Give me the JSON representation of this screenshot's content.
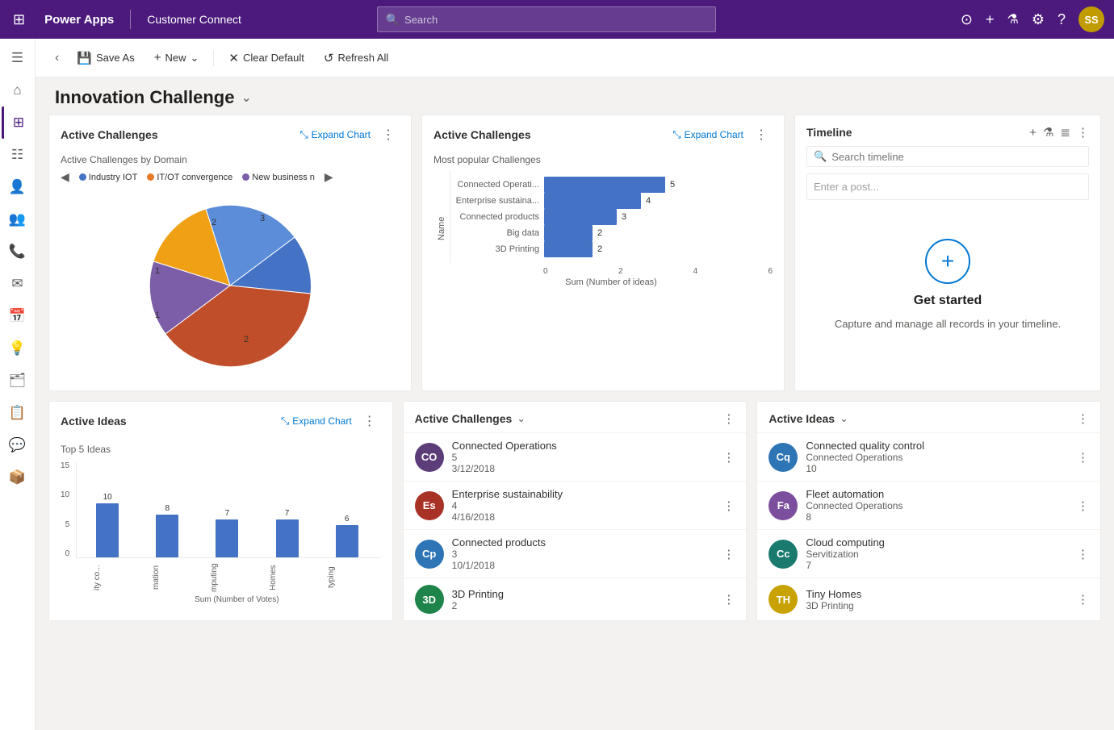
{
  "topnav": {
    "app_name": "Power Apps",
    "env_name": "Customer Connect",
    "search_placeholder": "Search",
    "avatar_initials": "SS"
  },
  "commandbar": {
    "back_title": "Back",
    "save_as": "Save As",
    "new": "New",
    "clear_default": "Clear Default",
    "refresh_all": "Refresh All"
  },
  "page": {
    "title": "Innovation Challenge",
    "title_chevron": "⌄"
  },
  "active_challenges_pie": {
    "title": "Active Challenges",
    "expand_label": "Expand Chart",
    "subtitle": "Active Challenges by Domain",
    "legend": [
      {
        "label": "Industry IOT",
        "color": "#4472c4"
      },
      {
        "label": "IT/OT convergence",
        "color": "#e87a24"
      },
      {
        "label": "New business n",
        "color": "#7b5ea7"
      }
    ],
    "slices": [
      {
        "label": "2",
        "color": "#4472c4",
        "value": 2
      },
      {
        "label": "3",
        "color": "#4472c4",
        "value": 3
      },
      {
        "label": "1",
        "color": "#f0a015",
        "value": 1
      },
      {
        "label": "1",
        "color": "#7b5ea7",
        "value": 1
      },
      {
        "label": "2",
        "color": "#c04e2a",
        "value": 2
      }
    ]
  },
  "active_challenges_bar": {
    "title": "Active Challenges",
    "expand_label": "Expand Chart",
    "subtitle": "Most popular Challenges",
    "bars": [
      {
        "label": "Connected Operati...",
        "value": 5,
        "max": 6
      },
      {
        "label": "Enterprise sustaina...",
        "value": 4,
        "max": 6
      },
      {
        "label": "Connected products",
        "value": 3,
        "max": 6
      },
      {
        "label": "Big data",
        "value": 2,
        "max": 6
      },
      {
        "label": "3D Printing",
        "value": 2,
        "max": 6
      }
    ],
    "y_label": "Name",
    "x_label": "Sum (Number of ideas)",
    "x_ticks": [
      "0",
      "2",
      "4",
      "6"
    ]
  },
  "timeline": {
    "title": "Timeline",
    "search_placeholder": "Search timeline",
    "post_placeholder": "Enter a post...",
    "empty_title": "Get started",
    "empty_text": "Capture and manage all records in your timeline."
  },
  "active_ideas_bar": {
    "title": "Active Ideas",
    "expand_label": "Expand Chart",
    "subtitle": "Top 5 Ideas",
    "bars": [
      {
        "label": "ity co...",
        "value": 10,
        "max": 15
      },
      {
        "label": "mation",
        "value": 8,
        "max": 15
      },
      {
        "label": "mputing",
        "value": 7,
        "max": 15
      },
      {
        "label": "Homes",
        "value": 7,
        "max": 15
      },
      {
        "label": "typing",
        "value": 6,
        "max": 15
      }
    ],
    "y_label": "Sum (Number of Votes)",
    "y_ticks": [
      "15",
      "10",
      "5",
      "0"
    ]
  },
  "active_challenges_list": {
    "title": "Active Challenges",
    "items": [
      {
        "initials": "CO",
        "color": "#5c3d7a",
        "name": "Connected Operations",
        "sub1": "5",
        "sub2": "3/12/2018"
      },
      {
        "initials": "Es",
        "color": "#a93226",
        "name": "Enterprise sustainability",
        "sub1": "4",
        "sub2": "4/16/2018"
      },
      {
        "initials": "Cp",
        "color": "#2e75b6",
        "name": "Connected products",
        "sub1": "3",
        "sub2": "10/1/2018"
      },
      {
        "initials": "3D",
        "color": "#1e8449",
        "name": "3D Printing",
        "sub1": "2",
        "sub2": ""
      }
    ]
  },
  "active_ideas_list": {
    "title": "Active Ideas",
    "items": [
      {
        "initials": "Cq",
        "color": "#2e75b6",
        "name": "Connected quality control",
        "sub1": "Connected Operations",
        "sub2": "10"
      },
      {
        "initials": "Fa",
        "color": "#7b4f9e",
        "name": "Fleet automation",
        "sub1": "Connected Operations",
        "sub2": "8"
      },
      {
        "initials": "Cc",
        "color": "#1a7a6e",
        "name": "Cloud computing",
        "sub1": "Servitization",
        "sub2": "7"
      },
      {
        "initials": "TH",
        "color": "#c8a200",
        "name": "Tiny Homes",
        "sub1": "3D Printing",
        "sub2": ""
      }
    ]
  },
  "sidebar": {
    "items": [
      {
        "icon": "≡",
        "name": "menu-icon"
      },
      {
        "icon": "⌂",
        "name": "home-icon"
      },
      {
        "icon": "⊞",
        "name": "dashboard-icon",
        "active": true
      },
      {
        "icon": "☰",
        "name": "records-icon"
      },
      {
        "icon": "👤",
        "name": "contacts-icon"
      },
      {
        "icon": "👥",
        "name": "accounts-icon"
      },
      {
        "icon": "📞",
        "name": "calls-icon"
      },
      {
        "icon": "✉",
        "name": "email-icon"
      },
      {
        "icon": "📅",
        "name": "calendar-icon"
      },
      {
        "icon": "💡",
        "name": "ideas-icon"
      },
      {
        "icon": "🗂",
        "name": "products-icon"
      },
      {
        "icon": "📋",
        "name": "cases-icon"
      },
      {
        "icon": "💬",
        "name": "chat-icon"
      },
      {
        "icon": "📦",
        "name": "inventory-icon"
      }
    ]
  }
}
